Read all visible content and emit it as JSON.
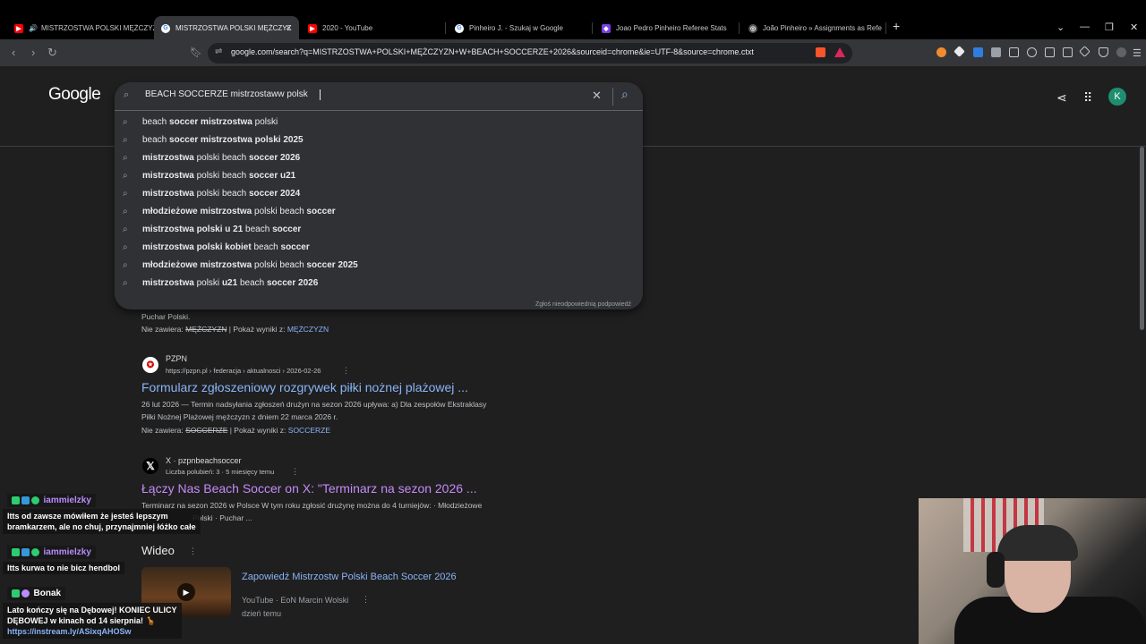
{
  "tabs": [
    {
      "label": "MISTRZOSTWA POLSKI MĘŻCZYZ",
      "active": false,
      "favicon": "youtube-icon"
    },
    {
      "label": "MISTRZOSTWA POLSKI MĘŻCZYZ",
      "active": true,
      "favicon": "google-icon"
    },
    {
      "label": "2020 - YouTube",
      "active": false,
      "favicon": "youtube-icon"
    },
    {
      "label": "Pinheiro J. - Szukaj w Google",
      "active": false,
      "favicon": "google-icon"
    },
    {
      "label": "Joao Pedro Pinheiro Referee Stats",
      "active": false,
      "favicon": "shield-icon"
    },
    {
      "label": "João Pinheiro » Assignments as Refe",
      "active": false,
      "favicon": "globe-icon"
    }
  ],
  "toolbar": {
    "url": "google.com/search?q=MISTRZOSTWA+POLSKI+MĘŻCZYZN+W+BEACH+SOCCERZE+2026&sourceid=chrome&ie=UTF-8&source=chrome.ctxt"
  },
  "google": {
    "logo": "Google",
    "query": "BEACH SOCCERZE mistrzostaww polsk",
    "suggestions": [
      {
        "parts": [
          [
            "beach ",
            false
          ],
          [
            "soccer mistrzostwa ",
            true
          ],
          [
            "polski",
            false
          ]
        ]
      },
      {
        "parts": [
          [
            "beach ",
            false
          ],
          [
            "soccer mistrzostwa ",
            true
          ],
          [
            "polski 2025",
            true
          ]
        ]
      },
      {
        "parts": [
          [
            "mistrzostwa ",
            true
          ],
          [
            "polski ",
            false
          ],
          [
            "beach ",
            false
          ],
          [
            "soccer 2026",
            true
          ]
        ]
      },
      {
        "parts": [
          [
            "mistrzostwa ",
            true
          ],
          [
            "polski ",
            false
          ],
          [
            "beach ",
            false
          ],
          [
            "soccer u21",
            true
          ]
        ]
      },
      {
        "parts": [
          [
            "mistrzostwa ",
            true
          ],
          [
            "polski ",
            false
          ],
          [
            "beach ",
            false
          ],
          [
            "soccer 2024",
            true
          ]
        ]
      },
      {
        "parts": [
          [
            "młodzieżowe mistrzostwa ",
            true
          ],
          [
            "polski ",
            false
          ],
          [
            "beach ",
            false
          ],
          [
            "soccer",
            true
          ]
        ]
      },
      {
        "parts": [
          [
            "mistrzostwa ",
            true
          ],
          [
            "polski u 21 ",
            true
          ],
          [
            "beach ",
            false
          ],
          [
            "soccer",
            true
          ]
        ]
      },
      {
        "parts": [
          [
            "mistrzostwa polski kobiet ",
            true
          ],
          [
            "beach ",
            false
          ],
          [
            "soccer",
            true
          ]
        ]
      },
      {
        "parts": [
          [
            "młodzieżowe mistrzostwa ",
            true
          ],
          [
            "polski ",
            false
          ],
          [
            "beach ",
            false
          ],
          [
            "soccer 2025",
            true
          ]
        ]
      },
      {
        "parts": [
          [
            "mistrzostwa ",
            true
          ],
          [
            "polski ",
            false
          ],
          [
            "u21 ",
            true
          ],
          [
            "beach ",
            false
          ],
          [
            "soccer 2026",
            true
          ]
        ]
      }
    ],
    "report": "Zgłoś nieodpowiednią podpowiedź",
    "avatar_letter": "K"
  },
  "results": {
    "r0": {
      "line1": "Puchar Polski.",
      "missing_label": "Nie zawiera: ",
      "missing_word": "MĘŻCZYZN",
      "show_label": " | Pokaż wyniki z: ",
      "show_word": "MĘŻCZYZN"
    },
    "r1": {
      "site": "PZPN",
      "cite": "https://pzpn.pl › federacja › aktualnosci › 2026-02-26",
      "title": "Formularz zgłoszeniowy rozgrywek piłki nożnej plażowej ...",
      "snip1": "26 lut 2026 — Termin nadsyłania zgłoszeń drużyn na sezon 2026 upływa: a) Dla zespołów Ekstraklasy",
      "snip2": "Piłki Nożnej Plażowej mężczyzn z dniem 22 marca 2026 r.",
      "missing_label": "Nie zawiera: ",
      "missing_word": "SOCCERZE",
      "show_label": " | Pokaż wyniki z: ",
      "show_word": "SOCCERZE"
    },
    "r2": {
      "site": "X · pzpnbeachsoccer",
      "cite": "Liczba polubień: 3 · 5 miesięcy temu",
      "title": "Łączy Nas Beach Soccer on X: \"Terminarz na sezon 2026 ...",
      "snip1": "Terminarz na sezon 2026 w Polsce W tym roku zgłosić drużynę można do 4 turniejów: · Młodzieżowe",
      "snip2": "Polski · Puchar ..."
    },
    "video_heading": "Wideo",
    "video": {
      "title": "Zapowiedź Mistrzostw Polski Beach Soccer 2026",
      "source": "YouTube · EoN Marcin Wolski",
      "age": "dzień temu"
    }
  },
  "chat": [
    {
      "user": "iammielzky",
      "text1": "Itts od zawsze mówiłem że jesteś lepszym",
      "text2": "bramkarzem, ale no chuj, przynajmniej łóżko całe"
    },
    {
      "user": "iammielzky",
      "text1": "Itts kurwa to nie bicz hendbol"
    },
    {
      "user": "Bonak",
      "text1": "Lato kończy się na Dębowej! KONIEC ULICY",
      "text2": "DĘBOWEJ w kinach od 14 sierpnia! 🦒",
      "link": "https://instream.ly/ASixqAHOSw"
    }
  ]
}
